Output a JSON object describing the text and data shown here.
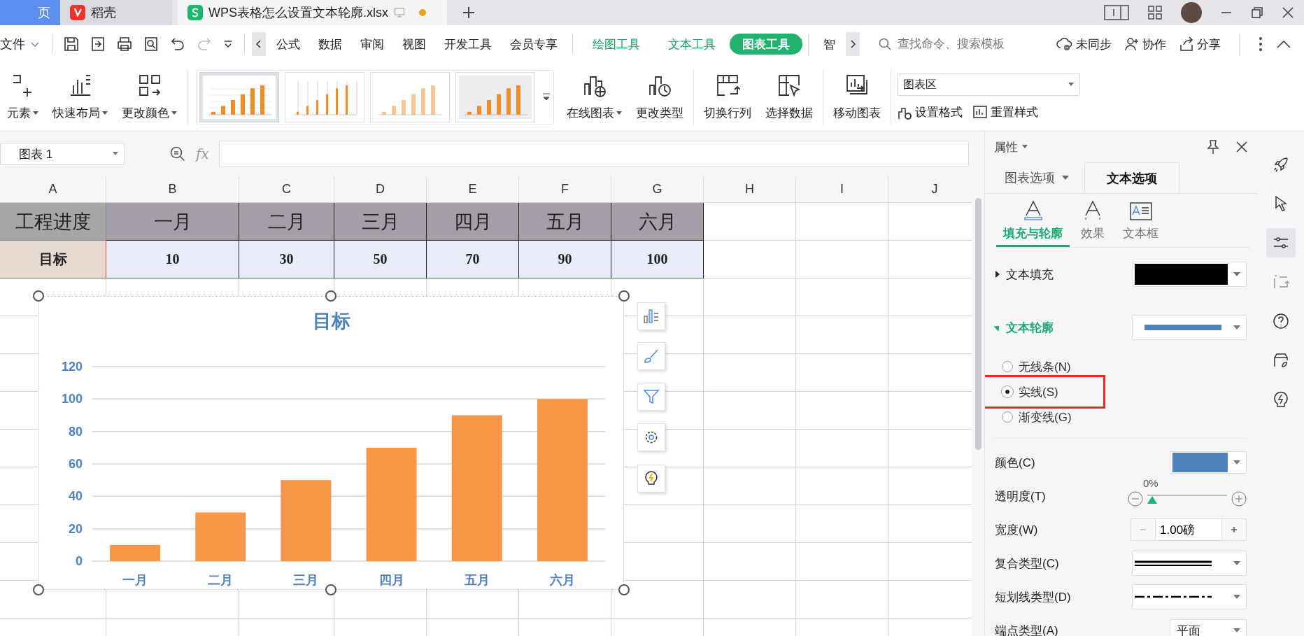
{
  "tabs": [
    {
      "label": "页",
      "kind": "home",
      "selected": false
    },
    {
      "label": "稻壳",
      "kind": "docer",
      "selected": false
    },
    {
      "label": "WPS表格怎么设置文本轮廓.xlsx",
      "kind": "sheet",
      "selected": true,
      "unsaved": true
    }
  ],
  "menu": {
    "file": "文件",
    "items": [
      {
        "label": "公式",
        "kind": "plain",
        "selected": false
      },
      {
        "label": "数据",
        "kind": "plain",
        "selected": false
      },
      {
        "label": "审阅",
        "kind": "plain",
        "selected": false
      },
      {
        "label": "视图",
        "kind": "plain",
        "selected": false
      },
      {
        "label": "开发工具",
        "kind": "plain",
        "selected": false
      },
      {
        "label": "会员专享",
        "kind": "plain",
        "selected": false
      },
      {
        "label": "绘图工具",
        "kind": "context",
        "selected": false
      },
      {
        "label": "文本工具",
        "kind": "context",
        "selected": false
      },
      {
        "label": "图表工具",
        "kind": "context",
        "selected": true
      },
      {
        "label": "智",
        "kind": "plain",
        "selected": false
      }
    ],
    "search": {
      "placeholder": "查找命令、搜索模板"
    },
    "actions": [
      "未同步",
      "协作",
      "分享"
    ]
  },
  "ribbon": {
    "left": [
      {
        "label": "元素",
        "dropdown": true
      },
      {
        "label": "快速布局",
        "dropdown": true
      },
      {
        "label": "更改颜色",
        "dropdown": true
      }
    ],
    "styles": [
      {
        "kind": "grid",
        "selected": true
      },
      {
        "kind": "columns",
        "selected": false
      },
      {
        "kind": "striped",
        "selected": false
      },
      {
        "kind": "shaded",
        "selected": false
      }
    ],
    "right": [
      {
        "label": "在线图表",
        "dropdown": true
      },
      {
        "label": "更改类型",
        "dropdown": false
      },
      {
        "label": "切换行列",
        "dropdown": false
      },
      {
        "label": "选择数据",
        "dropdown": false
      },
      {
        "label": "移动图表",
        "dropdown": false
      }
    ],
    "element_select": "图表区",
    "format_actions": [
      "设置格式",
      "重置样式"
    ]
  },
  "sheet": {
    "name_box": "图表 1",
    "fx": "fx",
    "columns": [
      "A",
      "B",
      "C",
      "D",
      "E",
      "F",
      "G",
      "H",
      "I",
      "J"
    ],
    "rows": [
      {
        "cells": [
          "工程进度",
          "一月",
          "二月",
          "三月",
          "四月",
          "五月",
          "六月"
        ]
      },
      {
        "cells": [
          "目标",
          "10",
          "30",
          "50",
          "70",
          "90",
          "100"
        ]
      }
    ],
    "chart": {
      "chart_data": {
        "type": "bar",
        "title": "目标",
        "categories": [
          "一月",
          "二月",
          "三月",
          "四月",
          "五月",
          "六月"
        ],
        "series": [
          {
            "color": "#f79646",
            "values": [
              10,
              30,
              50,
              70,
              90,
              100
            ]
          }
        ],
        "ylim": [
          0,
          120
        ],
        "yticks": [
          0,
          20,
          40,
          60,
          80,
          100,
          120
        ],
        "grid": true
      }
    }
  },
  "panel": {
    "title": "属性",
    "tabs": [
      {
        "label": "图表选项",
        "selected": false
      },
      {
        "label": "文本选项",
        "selected": true
      }
    ],
    "subtabs": [
      {
        "label": "填充与轮廓",
        "selected": true
      },
      {
        "label": "效果",
        "selected": false
      },
      {
        "label": "文本框",
        "selected": false
      }
    ],
    "fill": {
      "label": "文本填充",
      "expanded": false,
      "color": "#000000"
    },
    "outline": {
      "label": "文本轮廓",
      "expanded": true,
      "color": "#4f81bd",
      "options": [
        {
          "label": "无线条(N)",
          "selected": false,
          "highlighted": false
        },
        {
          "label": "实线(S)",
          "selected": true,
          "highlighted": true
        },
        {
          "label": "渐变线(G)",
          "selected": false,
          "highlighted": false
        }
      ]
    },
    "color": {
      "label": "颜色(C)",
      "color": "#4f81bd"
    },
    "transparency": {
      "label": "透明度(T)",
      "reading": "0%",
      "level": 0
    },
    "width": {
      "label": "宽度(W)",
      "value": "1.00磅"
    },
    "compound": {
      "label": "复合类型(C)"
    },
    "dash": {
      "label": "短划线类型(D)"
    },
    "cap": {
      "label": "端点类型(A)",
      "value": "平面"
    }
  },
  "sidebar_tools": [
    {
      "selected": false
    },
    {
      "selected": false
    },
    {
      "selected": true
    },
    {
      "selected": false
    },
    {
      "selected": false
    },
    {
      "selected": false
    },
    {
      "selected": false
    }
  ]
}
